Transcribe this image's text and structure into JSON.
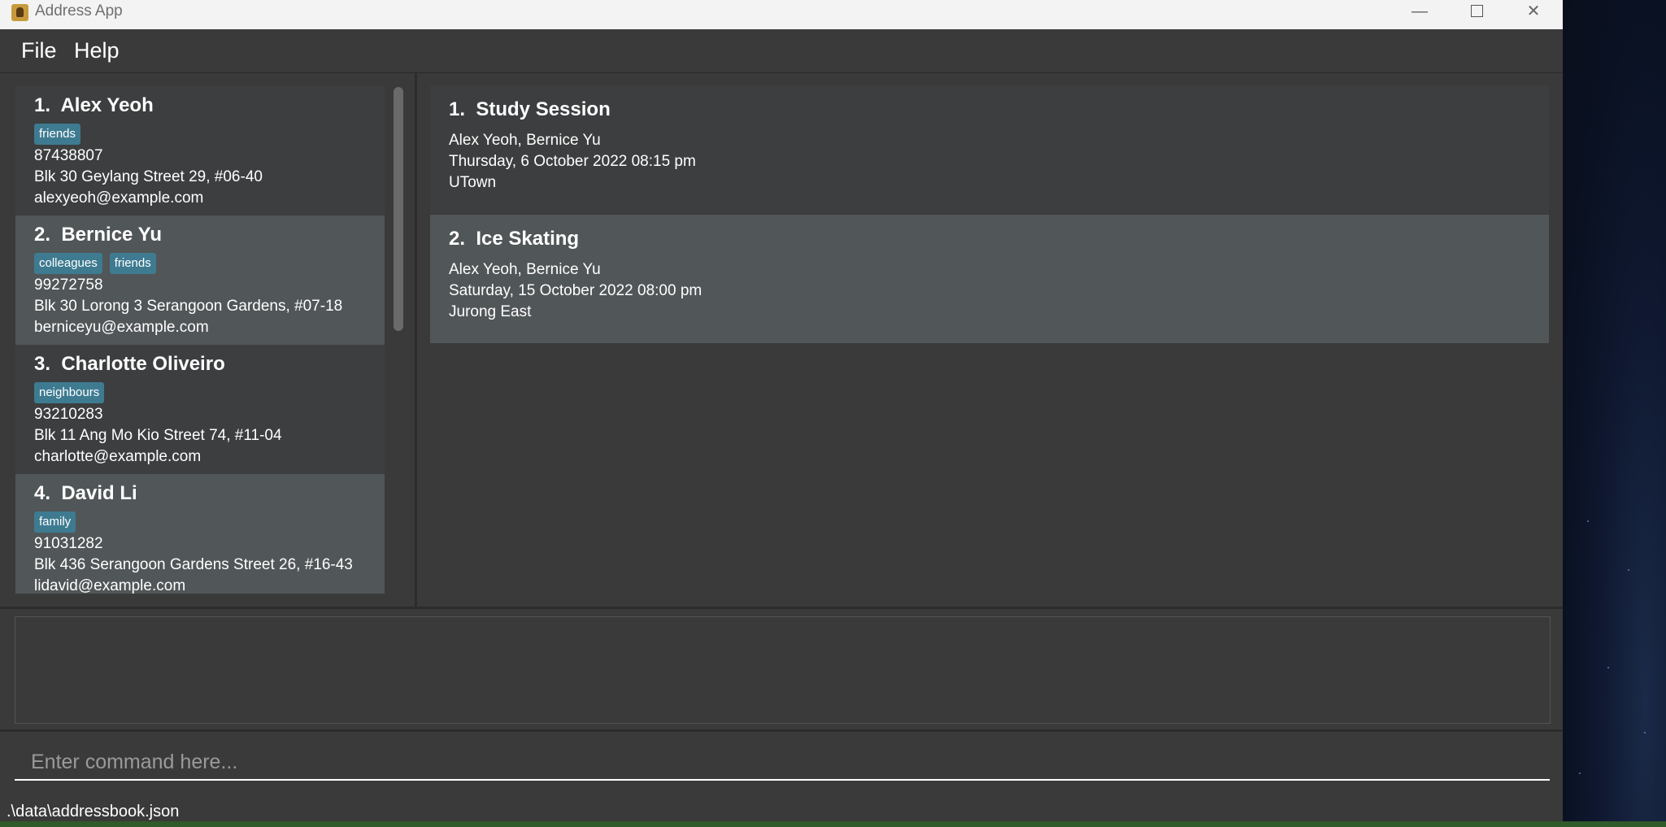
{
  "window": {
    "title": "Address App",
    "min_symbol": "—",
    "close_symbol": "✕"
  },
  "menu": {
    "file": "File",
    "help": "Help"
  },
  "persons": [
    {
      "index_name": "1.  Alex Yeoh",
      "tags": [
        "friends"
      ],
      "phone": "87438807",
      "address": "Blk 30 Geylang Street 29, #06-40",
      "email": "alexyeoh@example.com"
    },
    {
      "index_name": "2.  Bernice Yu",
      "tags": [
        "colleagues",
        "friends"
      ],
      "phone": "99272758",
      "address": "Blk 30 Lorong 3 Serangoon Gardens, #07-18",
      "email": "berniceyu@example.com"
    },
    {
      "index_name": "3.  Charlotte Oliveiro",
      "tags": [
        "neighbours"
      ],
      "phone": "93210283",
      "address": "Blk 11 Ang Mo Kio Street 74, #11-04",
      "email": "charlotte@example.com"
    },
    {
      "index_name": "4.  David Li",
      "tags": [
        "family"
      ],
      "phone": "91031282",
      "address": "Blk 436 Serangoon Gardens Street 26, #16-43",
      "email": "lidavid@example.com"
    }
  ],
  "meetups": [
    {
      "index_title": "1.  Study Session",
      "people": "Alex Yeoh, Bernice Yu",
      "datetime": "Thursday, 6 October 2022 08:15 pm",
      "location": "UTown"
    },
    {
      "index_title": "2.  Ice Skating",
      "people": "Alex Yeoh, Bernice Yu",
      "datetime": "Saturday, 15 October 2022 08:00 pm",
      "location": "Jurong East"
    }
  ],
  "result": {
    "text": ""
  },
  "command": {
    "value": "",
    "placeholder": "Enter command here..."
  },
  "status": {
    "file_path": ".\\data\\addressbook.json"
  },
  "colors": {
    "background": "#3a3a3a",
    "card_odd": "#3c3e3f",
    "card_even": "#515658",
    "tag": "#3e7b91"
  }
}
